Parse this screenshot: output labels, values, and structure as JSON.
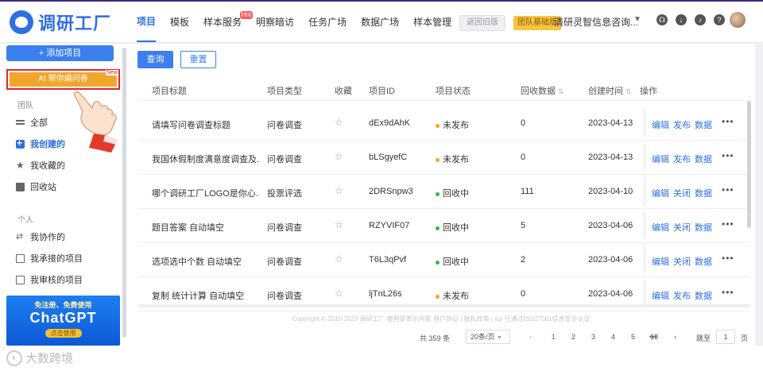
{
  "brand": {
    "name": "调研工厂"
  },
  "nav": {
    "items": [
      "项目",
      "模板",
      "样本服务",
      "明察暗访",
      "任务广场",
      "数据广场",
      "样本管理"
    ],
    "hot_badge": "Hot",
    "back_label": "返回旧版",
    "team_badge": "团队基础版",
    "org_name": "清研灵智信息咨询..."
  },
  "sidebar": {
    "add_label": "+ 添加项目",
    "ai_label": "AI 帮你编问卷",
    "ai_new": "New",
    "team_heading": "团队",
    "team_items": [
      "全部",
      "我创建的",
      "我收藏的",
      "回收站"
    ],
    "personal_heading": "个人",
    "personal_items": [
      "我协作的",
      "我承接的项目",
      "我审核的项目"
    ],
    "promo": {
      "line1": "免注册、免费使用",
      "line2": "ChatGPT",
      "line3": "点击使用"
    }
  },
  "toolbar": {
    "query_label": "查询",
    "reset_label": "重置"
  },
  "table": {
    "headers": [
      "项目标题",
      "项目类型",
      "收藏",
      "项目ID",
      "项目状态",
      "回收数据",
      "创建时间",
      "操作"
    ],
    "sort_icon": "⇅",
    "rows": [
      {
        "title": "请填写问卷调查标题",
        "type": "问卷调查",
        "id": "dEx9dAhK",
        "status": "未发布",
        "status_color": "orange",
        "count": "0",
        "date": "2023-04-13",
        "ops": [
          "编辑",
          "发布",
          "数据"
        ]
      },
      {
        "title": "我国休假制度满意度调查及...",
        "type": "问卷调查",
        "id": "bLSgyefC",
        "status": "未发布",
        "status_color": "orange",
        "count": "0",
        "date": "2023-04-13",
        "ops": [
          "编辑",
          "发布",
          "数据"
        ]
      },
      {
        "title": "哪个调研工厂LOGO是你心...",
        "type": "投票评选",
        "id": "2DRSnpw3",
        "status": "回收中",
        "status_color": "green",
        "count": "111",
        "date": "2023-04-10",
        "ops": [
          "编辑",
          "关闭",
          "数据"
        ]
      },
      {
        "title": "题目答案 自动填空",
        "type": "问卷调查",
        "id": "RZYVIF07",
        "status": "回收中",
        "status_color": "green",
        "count": "5",
        "date": "2023-04-06",
        "ops": [
          "编辑",
          "关闭",
          "数据"
        ]
      },
      {
        "title": "选项选中个数 自动填空",
        "type": "问卷调查",
        "id": "T6L3qPvf",
        "status": "回收中",
        "status_color": "green",
        "count": "2",
        "date": "2023-04-06",
        "ops": [
          "编辑",
          "关闭",
          "数据"
        ]
      },
      {
        "title": "复制 统计计算 自动填空",
        "type": "问卷调查",
        "id": "ljTnL26s",
        "status": "未发布",
        "status_color": "orange",
        "count": "0",
        "date": "2023-04-06",
        "ops": [
          "编辑",
          "发布",
          "数据"
        ]
      }
    ],
    "more_label": "•••"
  },
  "footer": {
    "copyright": "Copyright © 2010-2023 调研工厂 使用即表示同意 用户协议 | 隐私政策 | icp 已通过ISO27001信息安全认证"
  },
  "pagination": {
    "total": "共 359 条",
    "page_size": "20条/页",
    "pages": [
      "1",
      "2",
      "3",
      "4",
      "5",
      "•••",
      "18"
    ],
    "goto_label": "跳至",
    "goto_value": "1",
    "goto_suffix": "页"
  },
  "watermark": {
    "text": "大数跨境"
  }
}
